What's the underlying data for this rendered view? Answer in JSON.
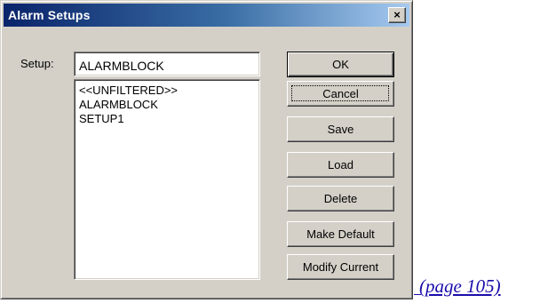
{
  "window": {
    "title": "Alarm Setups",
    "close_glyph": "×"
  },
  "setup": {
    "label": "Setup:",
    "value": "ALARMBLOCK"
  },
  "list": {
    "items": [
      "<<UNFILTERED>>",
      "ALARMBLOCK",
      "SETUP1"
    ]
  },
  "buttons": {
    "ok": "OK",
    "cancel": "Cancel",
    "save": "Save",
    "load": "Load",
    "delete": "Delete",
    "make_default": "Make Default",
    "modify_current": "Modify Current"
  },
  "page_link": {
    "text": "(page 105)"
  },
  "colors": {
    "dialog_face": "#d4d0c8",
    "titlebar_start": "#0a246a",
    "titlebar_end": "#a6caf0",
    "link": "#1a0dab"
  }
}
